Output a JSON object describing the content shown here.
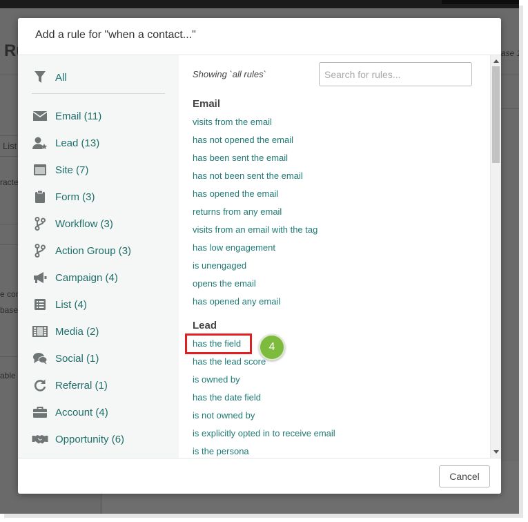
{
  "background": {
    "page_title_fragment": "Ru",
    "tab_fragment": "List",
    "text_fragments": [
      "racte",
      "e con",
      "base",
      "able"
    ],
    "right_fragment": "ase 1"
  },
  "modal": {
    "title": "Add a rule for \"when a contact...\"",
    "left_nav": {
      "all_label": "All",
      "items": [
        {
          "label": "Email (11)",
          "icon": "envelope-icon"
        },
        {
          "label": "Lead (13)",
          "icon": "user-star-icon"
        },
        {
          "label": "Site (7)",
          "icon": "browser-window-icon"
        },
        {
          "label": "Form (3)",
          "icon": "clipboard-icon"
        },
        {
          "label": "Workflow (3)",
          "icon": "branch-icon"
        },
        {
          "label": "Action Group (3)",
          "icon": "branch-icon"
        },
        {
          "label": "Campaign (4)",
          "icon": "megaphone-icon"
        },
        {
          "label": "List (4)",
          "icon": "list-icon"
        },
        {
          "label": "Media (2)",
          "icon": "film-icon"
        },
        {
          "label": "Social (1)",
          "icon": "speech-bubbles-icon"
        },
        {
          "label": "Referral (1)",
          "icon": "refresh-arrow-icon"
        },
        {
          "label": "Account (4)",
          "icon": "briefcase-icon"
        },
        {
          "label": "Opportunity (6)",
          "icon": "handshake-icon"
        }
      ]
    },
    "showing_text": "Showing `all rules`",
    "search_placeholder": "Search for rules...",
    "sections": [
      {
        "title": "Email",
        "rules": [
          "visits from the email",
          "has not opened the email",
          "has been sent the email",
          "has not been sent the email",
          "has opened the email",
          "returns from any email",
          "visits from an email with the tag",
          "has low engagement",
          "is unengaged",
          "opens the email",
          "has opened any email"
        ]
      },
      {
        "title": "Lead",
        "rules": [
          "has the field",
          "has the lead score",
          "is owned by",
          "has the date field",
          "is not owned by",
          "is explicitly opted in to receive email",
          "is the persona"
        ]
      }
    ],
    "callout_number": "4",
    "cancel_label": "Cancel"
  },
  "colors": {
    "link": "#1f7a75",
    "nav_label": "#1e6e6a",
    "highlight": "#e02020",
    "callout": "#7dbb3c"
  }
}
